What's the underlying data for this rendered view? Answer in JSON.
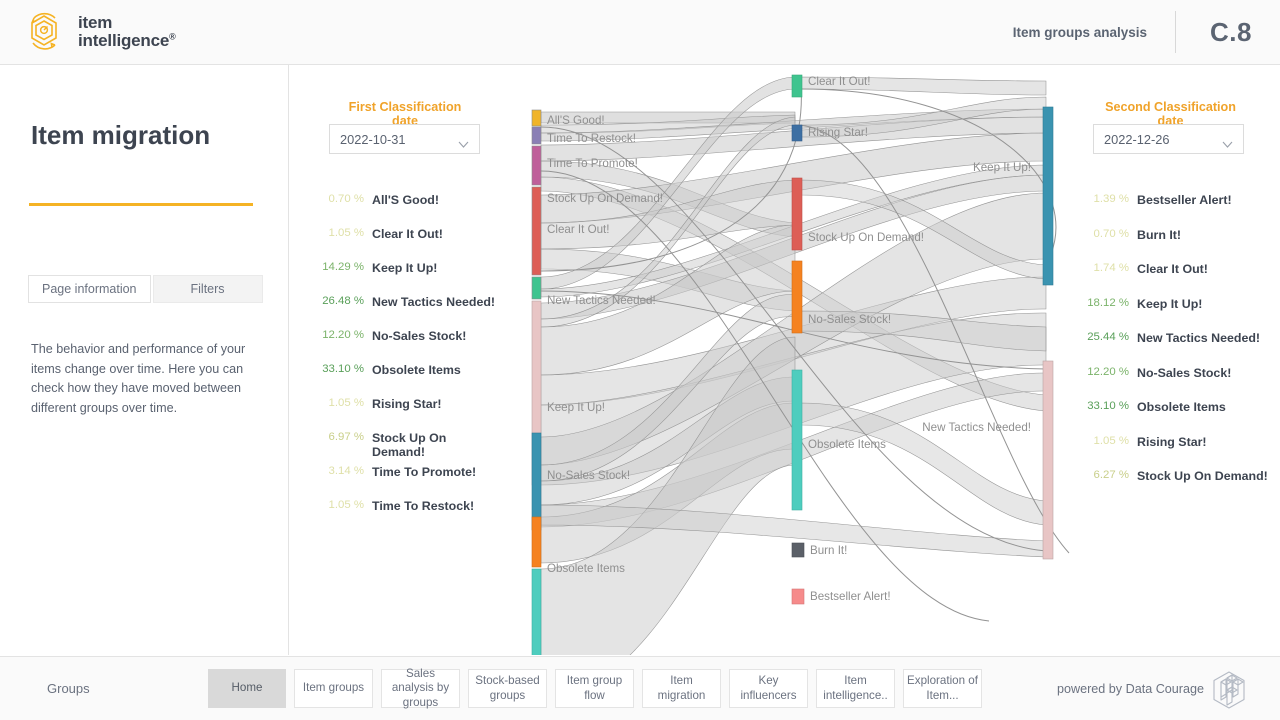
{
  "header": {
    "brand_line1": "item",
    "brand_line2": "intelligence",
    "brand_reg": "®",
    "brand_icon": "item-intelligence-logo",
    "analysis_label": "Item groups analysis",
    "code": "C.8"
  },
  "left_panel": {
    "title": "Item migration",
    "tabs": [
      {
        "label": "Page information",
        "active": false
      },
      {
        "label": "Filters",
        "active": true
      }
    ],
    "description": "The behavior and performance of your items change over time. Here you can check how they have moved between different groups over time."
  },
  "first_classification": {
    "heading": "First Classification date",
    "selected_date": "2022-10-31",
    "dropdown_icon": "chevron-down-icon",
    "items": [
      {
        "pct": "0.70 %",
        "label": "All'S Good!"
      },
      {
        "pct": "1.05 %",
        "label": "Clear It Out!"
      },
      {
        "pct": "14.29 %",
        "label": "Keep It Up!"
      },
      {
        "pct": "26.48 %",
        "label": "New Tactics Needed!"
      },
      {
        "pct": "12.20 %",
        "label": "No-Sales Stock!"
      },
      {
        "pct": "33.10 %",
        "label": "Obsolete Items"
      },
      {
        "pct": "1.05 %",
        "label": "Rising Star!"
      },
      {
        "pct": "6.97 %",
        "label": "Stock Up On Demand!"
      },
      {
        "pct": "3.14 %",
        "label": "Time To Promote!"
      },
      {
        "pct": "1.05 %",
        "label": "Time To Restock!"
      }
    ]
  },
  "second_classification": {
    "heading": "Second Classification date",
    "selected_date": "2022-12-26",
    "dropdown_icon": "chevron-down-icon",
    "items": [
      {
        "pct": "1.39 %",
        "label": "Bestseller Alert!"
      },
      {
        "pct": "0.70 %",
        "label": "Burn It!"
      },
      {
        "pct": "1.74 %",
        "label": "Clear It Out!"
      },
      {
        "pct": "18.12 %",
        "label": "Keep It Up!"
      },
      {
        "pct": "25.44 %",
        "label": "New Tactics Needed!"
      },
      {
        "pct": "12.20 %",
        "label": "No-Sales Stock!"
      },
      {
        "pct": "33.10 %",
        "label": "Obsolete Items"
      },
      {
        "pct": "1.05 %",
        "label": "Rising Star!"
      },
      {
        "pct": "6.27 %",
        "label": "Stock Up On Demand!"
      }
    ]
  },
  "chart_data": {
    "type": "sankey",
    "title": "Item migration",
    "xlabel": "",
    "ylabel": "",
    "legend_position": "sides",
    "grid": false,
    "source_column_label": "First Classification date",
    "target_column_label": "Second Classification date",
    "source_nodes": [
      {
        "name": "All'S Good!",
        "value": 0.7,
        "color": "#f0b429"
      },
      {
        "name": "Time To Restock!",
        "value": 1.05,
        "color": "#8a7fb5"
      },
      {
        "name": "Time To Promote!",
        "value": 3.14,
        "color": "#bf5f9a"
      },
      {
        "name": "Stock Up On Demand!",
        "value": 6.97,
        "color": "#dd5e56"
      },
      {
        "name": "Clear It Out!",
        "value": 1.05,
        "color": "#3fc48f"
      },
      {
        "name": "New Tactics Needed!",
        "value": 26.48,
        "color": "#e8c5c5"
      },
      {
        "name": "Keep It Up!",
        "value": 14.29,
        "color": "#3a93b0"
      },
      {
        "name": "No-Sales Stock!",
        "value": 12.2,
        "color": "#f58220"
      },
      {
        "name": "Obsolete Items",
        "value": 33.1,
        "color": "#4ecdbe"
      }
    ],
    "target_nodes": [
      {
        "name": "Clear It Out!",
        "value": 1.74,
        "color": "#3fc48f"
      },
      {
        "name": "Rising Star!",
        "value": 1.05,
        "color": "#3d6fa3"
      },
      {
        "name": "Stock Up On Demand!",
        "value": 6.27,
        "color": "#dd5e56"
      },
      {
        "name": "No-Sales Stock!",
        "value": 12.2,
        "color": "#f58220"
      },
      {
        "name": "Obsolete Items",
        "value": 33.1,
        "color": "#4ecdbe"
      },
      {
        "name": "Burn It!",
        "value": 0.7,
        "color": "#5b6068"
      },
      {
        "name": "Bestseller Alert!",
        "value": 1.39,
        "color": "#f68b8b"
      },
      {
        "name": "Keep It Up!",
        "value": 18.12,
        "color": "#3a93b0"
      },
      {
        "name": "New Tactics Needed!",
        "value": 25.44,
        "color": "#e8c5c5"
      }
    ],
    "flow_color": "#c9c9c9",
    "node_labels_left": [
      "All'S Good!",
      "Time To Restock!",
      "Time To Promote!",
      "Stock Up On Demand!",
      "Clear It Out!",
      "New Tactics Needed!",
      "Keep It Up!",
      "No-Sales Stock!",
      "Obsolete Items"
    ],
    "node_labels_mid": [
      "Clear It Out!",
      "Rising Star!",
      "Stock Up On Demand!",
      "No-Sales Stock!",
      "Obsolete Items",
      "Burn It!",
      "Bestseller Alert!"
    ],
    "node_labels_right": [
      "Keep It Up!",
      "New Tactics Needed!"
    ]
  },
  "footer": {
    "groups_label": "Groups",
    "nav_items": [
      {
        "label": "Home",
        "active": true
      },
      {
        "label": "Item groups",
        "active": false
      },
      {
        "label": "Sales analysis by groups",
        "active": false
      },
      {
        "label": "Stock-based groups",
        "active": false
      },
      {
        "label": "Item group flow",
        "active": false
      },
      {
        "label": "Item migration",
        "active": false
      },
      {
        "label": "Key influencers",
        "active": false
      },
      {
        "label": "Item intelligence..",
        "active": false
      },
      {
        "label": "Exploration of Item...",
        "active": false
      }
    ],
    "powered_by": "powered by Data Courage",
    "logo_icon": "data-courage-cubes-logo"
  },
  "colors": {
    "accent": "#f5b324",
    "text_dark": "#3d4450",
    "text_muted": "#6b7280"
  }
}
